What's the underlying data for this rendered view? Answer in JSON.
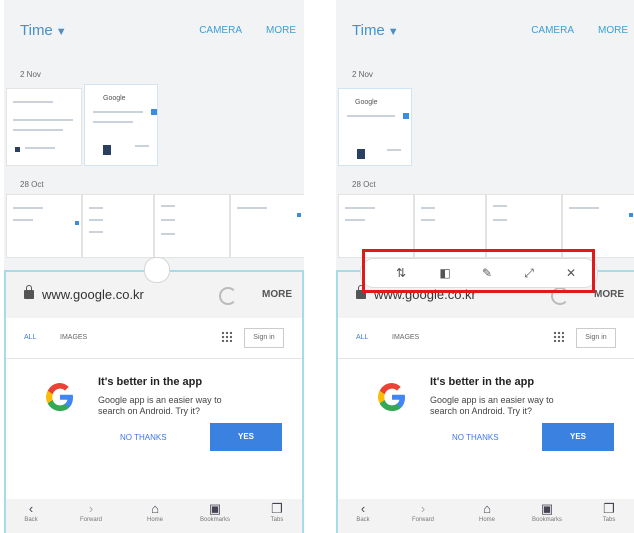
{
  "gallery": {
    "title": "Time",
    "camera_label": "CAMERA",
    "more_label": "MORE",
    "date1": "2 Nov",
    "date2": "28 Oct"
  },
  "browser": {
    "url": "www.google.co.kr",
    "more_label": "MORE",
    "tab_all": "ALL",
    "tab_images": "IMAGES",
    "signin": "Sign in",
    "promo_title": "It's better in the app",
    "promo_text": "Google app is an easier way to search on Android. Try it?",
    "no_thanks": "NO THANKS",
    "yes": "YES"
  },
  "nav": {
    "back": "Back",
    "forward": "Forward",
    "home": "Home",
    "bookmarks": "Bookmarks",
    "tabs": "Tabs"
  },
  "thumb_text": "Google",
  "colors": {
    "accent": "#3b82e0",
    "highlight": "#e01a1a",
    "panel_border": "#a8dbe8"
  },
  "popup_toolbar": {
    "icons": [
      "swap-icon",
      "capture-icon",
      "edit-icon",
      "resize-icon",
      "close-icon"
    ]
  }
}
